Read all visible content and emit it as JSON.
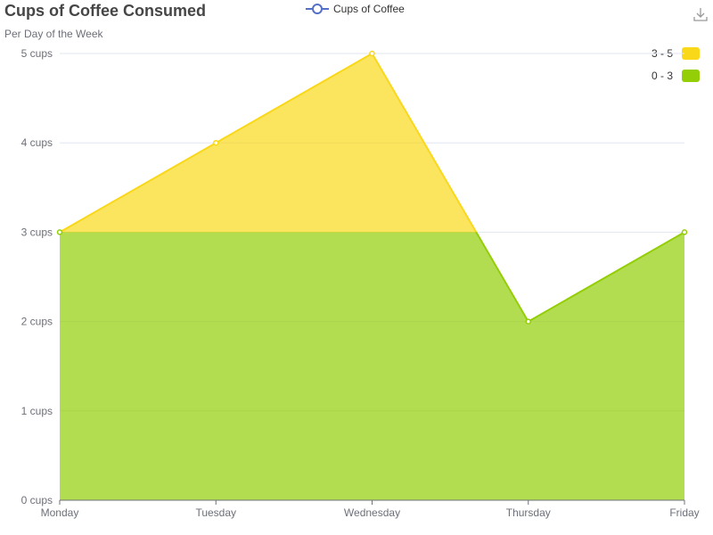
{
  "chart_data": {
    "type": "area",
    "title": "Cups of Coffee Consumed",
    "subtitle": "Per Day of the Week",
    "categories": [
      "Monday",
      "Tuesday",
      "Wednesday",
      "Thursday",
      "Friday"
    ],
    "series": [
      {
        "name": "Cups of Coffee",
        "values": [
          3,
          4,
          5,
          2,
          3
        ]
      }
    ],
    "y_tick_labels": [
      "0 cups",
      "1 cups",
      "2 cups",
      "3 cups",
      "4 cups",
      "5 cups"
    ],
    "ylim": [
      0,
      5
    ],
    "grid": "horizontal",
    "legend_position": "top-center",
    "visual_map": {
      "position": "top-right",
      "pieces": [
        {
          "label": "3 - 5",
          "min": 3,
          "max": 5,
          "color": "#f9d81a"
        },
        {
          "label": "0 - 3",
          "min": 0,
          "max": 3,
          "color": "#93ce07"
        }
      ]
    },
    "colors": {
      "legend_line": "#5470c6",
      "grid_line": "#e0e6f1",
      "axis_line": "#6e7079"
    }
  },
  "toolbox": {
    "download_icon": "download-icon"
  }
}
